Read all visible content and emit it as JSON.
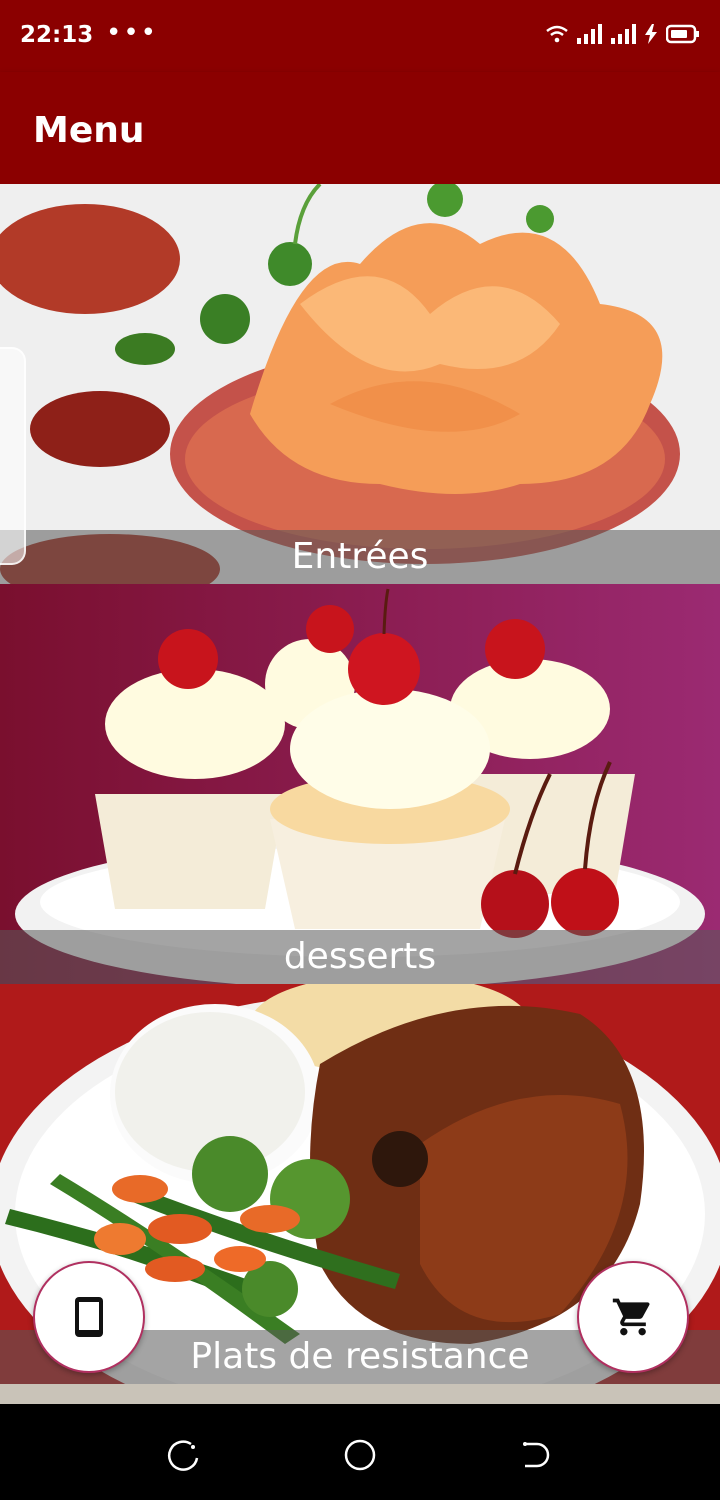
{
  "status": {
    "time": "22:13",
    "dots": "•••"
  },
  "appbar": {
    "title": "Menu"
  },
  "categories": [
    {
      "label": "Entrées"
    },
    {
      "label": "desserts"
    },
    {
      "label": "Plats de resistance"
    }
  ],
  "fabs": {
    "left_icon": "phone-icon",
    "right_icon": "cart-icon"
  },
  "colors": {
    "primary": "#8B0000",
    "fab_border": "#b03060"
  }
}
